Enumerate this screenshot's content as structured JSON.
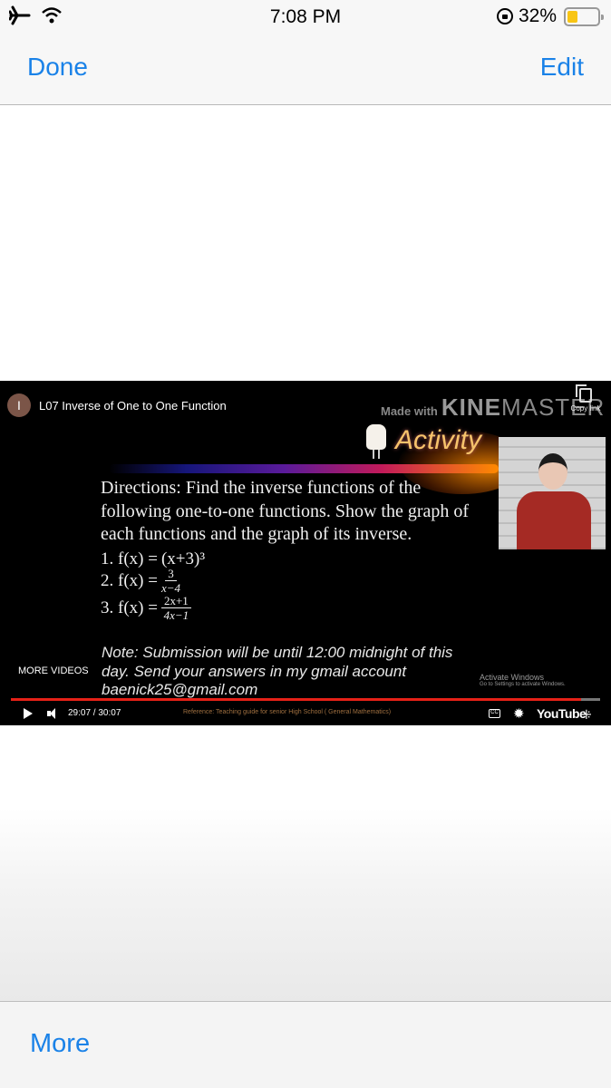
{
  "status_bar": {
    "time": "7:08 PM",
    "battery_percent_label": "32%",
    "battery_level": 0.32,
    "icons": [
      "airplane-mode-icon",
      "wifi-icon",
      "orientation-lock-icon",
      "battery-icon"
    ]
  },
  "nav": {
    "done_label": "Done",
    "edit_label": "Edit"
  },
  "video": {
    "channel_initial": "I",
    "title": "L07 Inverse of One to One Function",
    "copy_link_label": "Copy link",
    "watermark_made_with": "Made with",
    "watermark_brand_bold": "KINE",
    "watermark_brand_light": "MASTER",
    "slide": {
      "heading": "Activity",
      "directions": [
        "Directions: Find the inverse functions of the",
        "following one-to-one functions. Show the graph of",
        "each functions and the graph of its inverse."
      ],
      "equations": [
        {
          "label": "1. f(x) =",
          "expr": "(x+3)³"
        },
        {
          "label": "2. f(x) =",
          "numerator": "3",
          "denominator": "x−4"
        },
        {
          "label": "3. f(x) =",
          "numerator": "2x+1",
          "denominator": "4x−1"
        }
      ],
      "note_lines": [
        "Note: Submission will be until 12:00 midnight of this",
        "day. Send your answers in my gmail account",
        "baenick25@gmail.com"
      ],
      "reference": "Reference: Teaching guide for senior High School ( General Mathematics)"
    },
    "more_videos_label": "MORE VIDEOS",
    "activate_windows_title": "Activate Windows",
    "activate_windows_sub": "Go to Settings to activate Windows.",
    "current_time": "29:07",
    "duration": "30:07",
    "time_display": "29:07 / 30:07",
    "progress_fraction": 0.967,
    "cc_label": "CC",
    "youtube_label": "YouTube",
    "accent_color": "#e62117"
  },
  "toolbar": {
    "more_label": "More"
  },
  "colors": {
    "ios_blue": "#1a82e8",
    "battery_yellow": "#f8c514"
  }
}
